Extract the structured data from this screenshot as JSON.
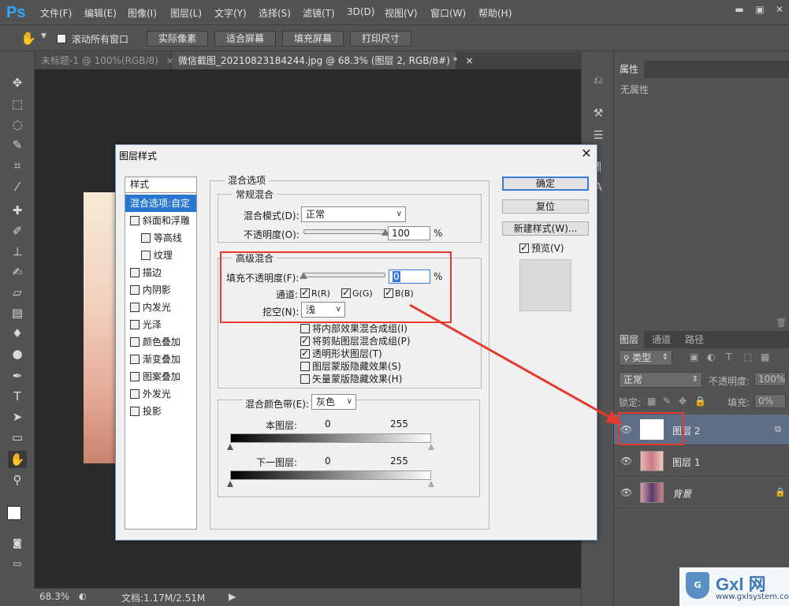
{
  "app": {
    "logo": "Ps"
  },
  "menu": [
    "文件(F)",
    "编辑(E)",
    "图像(I)",
    "图层(L)",
    "文字(Y)",
    "选择(S)",
    "滤镜(T)",
    "3D(D)",
    "视图(V)",
    "窗口(W)",
    "帮助(H)"
  ],
  "window_controls": {
    "minimize": "▬",
    "restore": "▣",
    "close": "✕"
  },
  "options_bar": {
    "scroll_all": "滚动所有窗口",
    "buttons": [
      "实际像素",
      "适合屏幕",
      "填充屏幕",
      "打印尺寸"
    ]
  },
  "tabs": [
    {
      "label": "未标题-1 @ 100%(RGB/8)",
      "close": "×"
    },
    {
      "label": "微信截图_20210823184244.jpg @ 68.3% (图层 2, RGB/8#) *",
      "close": "×"
    }
  ],
  "status": {
    "zoom": "68.3%",
    "doc": "文档:1.17M/2.51M",
    "arrow": "▶"
  },
  "properties": {
    "tab": "属性",
    "empty": "无属性"
  },
  "layers_panel": {
    "tabs": [
      "图层",
      "通道",
      "路径"
    ],
    "filter": "类型",
    "blend_mode": "正常",
    "opacity_label": "不透明度:",
    "opacity_value": "100%",
    "lock_label": "锁定:",
    "fill_label": "填充:",
    "fill_value": "0%",
    "layers": [
      {
        "name": "图层 2",
        "selected": true
      },
      {
        "name": "图层 1",
        "selected": false
      },
      {
        "name": "背景",
        "selected": false
      }
    ]
  },
  "dialog": {
    "title": "图层样式",
    "close": "✕",
    "styles_header": "样式",
    "styles": [
      {
        "label": "混合选项:自定",
        "checkbox": false,
        "selected": true,
        "indent": 0
      },
      {
        "label": "斜面和浮雕",
        "checkbox": true,
        "selected": false,
        "indent": 0
      },
      {
        "label": "等高线",
        "checkbox": true,
        "selected": false,
        "indent": 1
      },
      {
        "label": "纹理",
        "checkbox": true,
        "selected": false,
        "indent": 1
      },
      {
        "label": "描边",
        "checkbox": true,
        "selected": false,
        "indent": 0
      },
      {
        "label": "内阴影",
        "checkbox": true,
        "selected": false,
        "indent": 0
      },
      {
        "label": "内发光",
        "checkbox": true,
        "selected": false,
        "indent": 0
      },
      {
        "label": "光泽",
        "checkbox": true,
        "selected": false,
        "indent": 0
      },
      {
        "label": "颜色叠加",
        "checkbox": true,
        "selected": false,
        "indent": 0
      },
      {
        "label": "渐变叠加",
        "checkbox": true,
        "selected": false,
        "indent": 0
      },
      {
        "label": "图案叠加",
        "checkbox": true,
        "selected": false,
        "indent": 0
      },
      {
        "label": "外发光",
        "checkbox": true,
        "selected": false,
        "indent": 0
      },
      {
        "label": "投影",
        "checkbox": true,
        "selected": false,
        "indent": 0
      }
    ],
    "blend_options": "混合选项",
    "general": {
      "title": "常规混合",
      "mode_label": "混合模式(D):",
      "mode_value": "正常",
      "opacity_label": "不透明度(O):",
      "opacity_value": "100",
      "opacity_unit": "%",
      "opacity_level": 1.0
    },
    "advanced": {
      "title": "高级混合",
      "fill_label": "填充不透明度(F):",
      "fill_value": "0",
      "fill_unit": "%",
      "fill_level": 0.0,
      "channels_label": "通道:",
      "channel_r": "R(R)",
      "channel_g": "G(G)",
      "channel_b": "B(B)",
      "knockout_label": "挖空(N):",
      "knockout_value": "浅",
      "options": [
        {
          "label": "将内部效果混合成组(I)",
          "checked": false
        },
        {
          "label": "将剪贴图层混合成组(P)",
          "checked": true
        },
        {
          "label": "透明形状图层(T)",
          "checked": true
        },
        {
          "label": "图层蒙版隐藏效果(S)",
          "checked": false
        },
        {
          "label": "矢量蒙版隐藏效果(H)",
          "checked": false
        }
      ]
    },
    "blend_if": {
      "label": "混合颜色带(E):",
      "value": "灰色",
      "this_layer": "本图层:",
      "underlying": "下一图层:",
      "low": "0",
      "high": "255"
    },
    "buttons": {
      "ok": "确定",
      "reset": "复位",
      "new_style": "新建样式(W)...",
      "preview": "预览(V)"
    }
  },
  "watermark": {
    "brand": "Gxl 网",
    "url": "www.gxlsystem.com"
  },
  "colors": {
    "accent": "#2878d2",
    "annotation": "#e53a2e",
    "ps_blue": "#31a8ff"
  }
}
